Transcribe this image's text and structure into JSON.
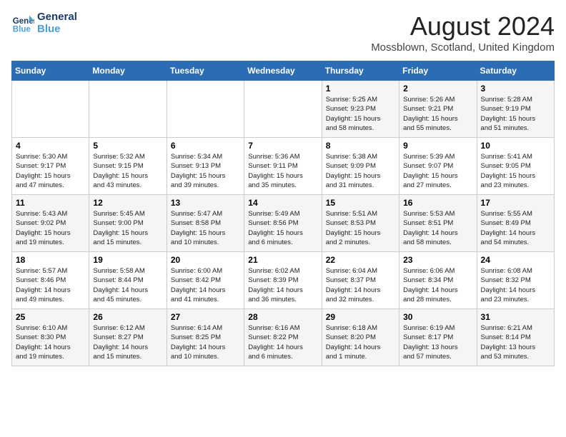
{
  "header": {
    "logo_line1": "General",
    "logo_line2": "Blue",
    "month_year": "August 2024",
    "location": "Mossblown, Scotland, United Kingdom"
  },
  "weekdays": [
    "Sunday",
    "Monday",
    "Tuesday",
    "Wednesday",
    "Thursday",
    "Friday",
    "Saturday"
  ],
  "weeks": [
    [
      {
        "day": "",
        "info": ""
      },
      {
        "day": "",
        "info": ""
      },
      {
        "day": "",
        "info": ""
      },
      {
        "day": "",
        "info": ""
      },
      {
        "day": "1",
        "info": "Sunrise: 5:25 AM\nSunset: 9:23 PM\nDaylight: 15 hours\nand 58 minutes."
      },
      {
        "day": "2",
        "info": "Sunrise: 5:26 AM\nSunset: 9:21 PM\nDaylight: 15 hours\nand 55 minutes."
      },
      {
        "day": "3",
        "info": "Sunrise: 5:28 AM\nSunset: 9:19 PM\nDaylight: 15 hours\nand 51 minutes."
      }
    ],
    [
      {
        "day": "4",
        "info": "Sunrise: 5:30 AM\nSunset: 9:17 PM\nDaylight: 15 hours\nand 47 minutes."
      },
      {
        "day": "5",
        "info": "Sunrise: 5:32 AM\nSunset: 9:15 PM\nDaylight: 15 hours\nand 43 minutes."
      },
      {
        "day": "6",
        "info": "Sunrise: 5:34 AM\nSunset: 9:13 PM\nDaylight: 15 hours\nand 39 minutes."
      },
      {
        "day": "7",
        "info": "Sunrise: 5:36 AM\nSunset: 9:11 PM\nDaylight: 15 hours\nand 35 minutes."
      },
      {
        "day": "8",
        "info": "Sunrise: 5:38 AM\nSunset: 9:09 PM\nDaylight: 15 hours\nand 31 minutes."
      },
      {
        "day": "9",
        "info": "Sunrise: 5:39 AM\nSunset: 9:07 PM\nDaylight: 15 hours\nand 27 minutes."
      },
      {
        "day": "10",
        "info": "Sunrise: 5:41 AM\nSunset: 9:05 PM\nDaylight: 15 hours\nand 23 minutes."
      }
    ],
    [
      {
        "day": "11",
        "info": "Sunrise: 5:43 AM\nSunset: 9:02 PM\nDaylight: 15 hours\nand 19 minutes."
      },
      {
        "day": "12",
        "info": "Sunrise: 5:45 AM\nSunset: 9:00 PM\nDaylight: 15 hours\nand 15 minutes."
      },
      {
        "day": "13",
        "info": "Sunrise: 5:47 AM\nSunset: 8:58 PM\nDaylight: 15 hours\nand 10 minutes."
      },
      {
        "day": "14",
        "info": "Sunrise: 5:49 AM\nSunset: 8:56 PM\nDaylight: 15 hours\nand 6 minutes."
      },
      {
        "day": "15",
        "info": "Sunrise: 5:51 AM\nSunset: 8:53 PM\nDaylight: 15 hours\nand 2 minutes."
      },
      {
        "day": "16",
        "info": "Sunrise: 5:53 AM\nSunset: 8:51 PM\nDaylight: 14 hours\nand 58 minutes."
      },
      {
        "day": "17",
        "info": "Sunrise: 5:55 AM\nSunset: 8:49 PM\nDaylight: 14 hours\nand 54 minutes."
      }
    ],
    [
      {
        "day": "18",
        "info": "Sunrise: 5:57 AM\nSunset: 8:46 PM\nDaylight: 14 hours\nand 49 minutes."
      },
      {
        "day": "19",
        "info": "Sunrise: 5:58 AM\nSunset: 8:44 PM\nDaylight: 14 hours\nand 45 minutes."
      },
      {
        "day": "20",
        "info": "Sunrise: 6:00 AM\nSunset: 8:42 PM\nDaylight: 14 hours\nand 41 minutes."
      },
      {
        "day": "21",
        "info": "Sunrise: 6:02 AM\nSunset: 8:39 PM\nDaylight: 14 hours\nand 36 minutes."
      },
      {
        "day": "22",
        "info": "Sunrise: 6:04 AM\nSunset: 8:37 PM\nDaylight: 14 hours\nand 32 minutes."
      },
      {
        "day": "23",
        "info": "Sunrise: 6:06 AM\nSunset: 8:34 PM\nDaylight: 14 hours\nand 28 minutes."
      },
      {
        "day": "24",
        "info": "Sunrise: 6:08 AM\nSunset: 8:32 PM\nDaylight: 14 hours\nand 23 minutes."
      }
    ],
    [
      {
        "day": "25",
        "info": "Sunrise: 6:10 AM\nSunset: 8:30 PM\nDaylight: 14 hours\nand 19 minutes."
      },
      {
        "day": "26",
        "info": "Sunrise: 6:12 AM\nSunset: 8:27 PM\nDaylight: 14 hours\nand 15 minutes."
      },
      {
        "day": "27",
        "info": "Sunrise: 6:14 AM\nSunset: 8:25 PM\nDaylight: 14 hours\nand 10 minutes."
      },
      {
        "day": "28",
        "info": "Sunrise: 6:16 AM\nSunset: 8:22 PM\nDaylight: 14 hours\nand 6 minutes."
      },
      {
        "day": "29",
        "info": "Sunrise: 6:18 AM\nSunset: 8:20 PM\nDaylight: 14 hours\nand 1 minute."
      },
      {
        "day": "30",
        "info": "Sunrise: 6:19 AM\nSunset: 8:17 PM\nDaylight: 13 hours\nand 57 minutes."
      },
      {
        "day": "31",
        "info": "Sunrise: 6:21 AM\nSunset: 8:14 PM\nDaylight: 13 hours\nand 53 minutes."
      }
    ]
  ]
}
